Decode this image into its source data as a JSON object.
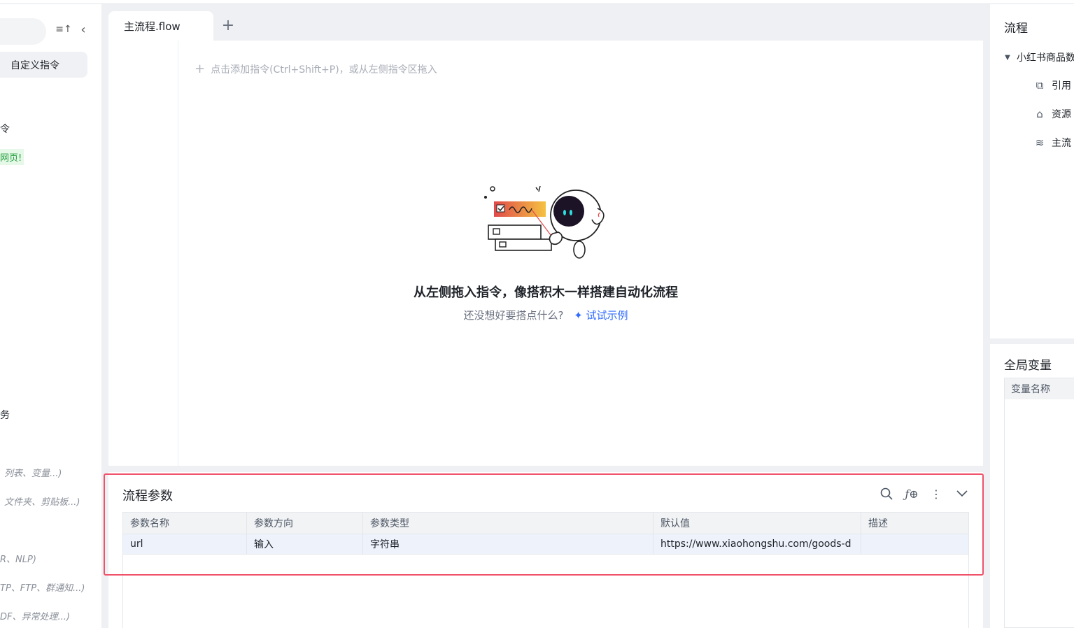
{
  "left": {
    "custom_instruction": "自定义指令",
    "items": [
      {
        "text": "令"
      },
      {
        "text": "网页!"
      },
      {
        "text": "务"
      },
      {
        "text": "列表、变量...)"
      },
      {
        "text": "文件夹、剪贴板...)"
      },
      {
        "text": "R、NLP)"
      },
      {
        "text": "TP、FTP、群通知...)"
      },
      {
        "text": "DF、异常处理...)"
      }
    ]
  },
  "tabs": [
    {
      "label": "主流程.flow"
    }
  ],
  "tab_add": "+",
  "canvas": {
    "add_hint": "点击添加指令(Ctrl+Shift+P)，或从左侧指令区拖入",
    "empty_title": "从左侧拖入指令，像搭积木一样搭建自动化流程",
    "empty_sub": "还没想好要搭点什么?",
    "try_example": "试试示例"
  },
  "params": {
    "title": "流程参数",
    "columns": [
      "参数名称",
      "参数方向",
      "参数类型",
      "默认值",
      "描述"
    ],
    "rows": [
      [
        "url",
        "输入",
        "字符串",
        "https://www.xiaohongshu.com/goods-d",
        ""
      ]
    ]
  },
  "right": {
    "flow_title": "流程",
    "tree_root": "小红书商品数",
    "tree_items": [
      "引用",
      "资源",
      "主流"
    ],
    "global_vars_title": "全局变量",
    "var_col": "变量名称"
  },
  "icons": {
    "search": "search-icon",
    "fx": "fx-icon",
    "more": "more-icon",
    "collapse": "chevron-down-icon"
  }
}
